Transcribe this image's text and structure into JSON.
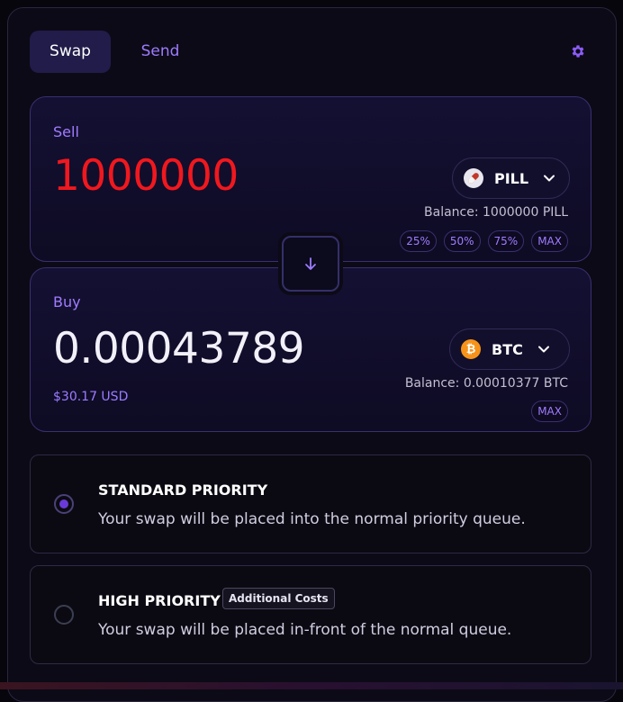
{
  "tabs": {
    "swap": "Swap",
    "send": "Send"
  },
  "sell": {
    "label": "Sell",
    "amount": "1000000",
    "token": "PILL",
    "balance": "Balance: 1000000 PILL",
    "percent_buttons": [
      "25%",
      "50%",
      "75%",
      "MAX"
    ]
  },
  "buy": {
    "label": "Buy",
    "amount": "0.00043789",
    "usd_value": "$30.17 USD",
    "token": "BTC",
    "token_icon_glyph": "₿",
    "balance": "Balance: 0.00010377 BTC",
    "max": "MAX"
  },
  "priority": {
    "standard": {
      "title": "STANDARD PRIORITY",
      "description": "Your swap will be placed into the normal priority queue.",
      "selected": true
    },
    "high": {
      "title": "HIGH PRIORITY",
      "badge": "Additional Costs",
      "description": "Your swap will be placed in-front of the normal queue.",
      "selected": false
    }
  },
  "colors": {
    "accent": "#9d7bff",
    "sell_amount": "#f0181e",
    "btc": "#f7931a"
  },
  "icons": {
    "settings": "gear-icon",
    "flip": "arrow-down-icon",
    "dropdown": "chevron-down-icon"
  }
}
